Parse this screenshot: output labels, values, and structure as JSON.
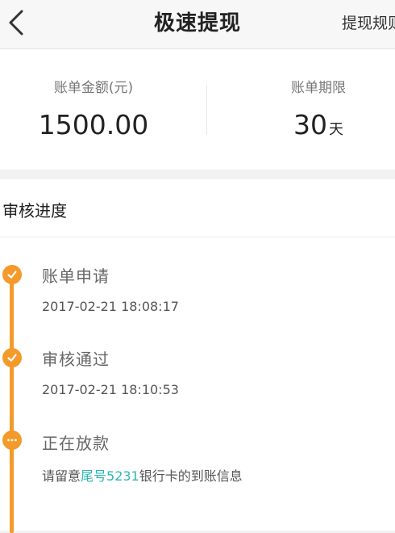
{
  "header": {
    "title": "极速提现",
    "rules_link": "提现规则"
  },
  "summary": {
    "amount_label": "账单金额(元)",
    "amount_value": "1500.00",
    "term_label": "账单期限",
    "term_value": "30",
    "term_unit": "天"
  },
  "progress": {
    "section_title": "审核进度",
    "steps": [
      {
        "title": "账单申请",
        "time": "2017-02-21 18:08:17",
        "icon": "check-icon"
      },
      {
        "title": "审核通过",
        "time": "2017-02-21 18:10:53",
        "icon": "check-icon"
      },
      {
        "title": "正在放款",
        "icon": "ellipsis-icon",
        "note_prefix": "请留意",
        "note_highlight": "尾号5231",
        "note_suffix": "银行卡的到账信息"
      }
    ]
  },
  "colors": {
    "accent": "#f39a2a",
    "highlight": "#2bb5b0"
  }
}
